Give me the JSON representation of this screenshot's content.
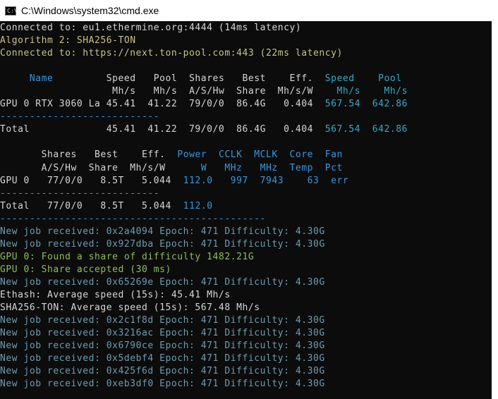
{
  "window": {
    "title": "C:\\Windows\\system32\\cmd.exe",
    "icon": "cmd-icon",
    "icon_glyph": "C:\\"
  },
  "lines": [
    {
      "spans": [
        {
          "t": "Connected to: eu1.ethermine.org:4444 (14ms latency)",
          "c": "w"
        }
      ]
    },
    {
      "spans": [
        {
          "t": "Algorithm 2: SHA256-TON",
          "c": "y"
        }
      ]
    },
    {
      "spans": [
        {
          "t": "Connected to: https://next.ton-pool.com:443 (22ms latency)",
          "c": "y"
        }
      ]
    },
    {
      "spans": [
        {
          "t": "",
          "c": "w"
        }
      ]
    },
    {
      "spans": [
        {
          "t": "     Name         ",
          "c": "c"
        },
        {
          "t": "Speed   Pool  Shares   Best    Eff.  ",
          "c": "w"
        },
        {
          "t": "Speed    Pool",
          "c": "cy"
        }
      ]
    },
    {
      "spans": [
        {
          "t": "                   ",
          "c": "w"
        },
        {
          "t": "Mh/s   Mh/s  A/S/Hw  Share  Mh/s/W    ",
          "c": "w"
        },
        {
          "t": "Mh/s    Mh/s",
          "c": "cy"
        }
      ]
    },
    {
      "spans": [
        {
          "t": "GPU 0 RTX 3060 La 45.41  41.22  79/0/0  86.4G   0.404  ",
          "c": "w"
        },
        {
          "t": "567.54  642.86",
          "c": "cy"
        }
      ]
    },
    {
      "spans": [
        {
          "t": "---------------------------",
          "c": "c"
        }
      ]
    },
    {
      "spans": [
        {
          "t": "Total             45.41  41.22  79/0/0  86.4G   0.404  ",
          "c": "w"
        },
        {
          "t": "567.54  642.86",
          "c": "cy"
        }
      ]
    },
    {
      "spans": [
        {
          "t": "",
          "c": "w"
        }
      ]
    },
    {
      "spans": [
        {
          "t": "       Shares   Best    Eff.  ",
          "c": "w"
        },
        {
          "t": "Power  CCLK  MCLK  Core  Fan",
          "c": "c"
        }
      ]
    },
    {
      "spans": [
        {
          "t": "       A/S/Hw  Share  Mh/s/W      ",
          "c": "w"
        },
        {
          "t": "W   MHz   MHz  Temp  Pct",
          "c": "c"
        }
      ]
    },
    {
      "spans": [
        {
          "t": "GPU 0   77/0/0   8.5T   5.044  ",
          "c": "w"
        },
        {
          "t": "112.0   997  7943    63  err",
          "c": "c"
        }
      ]
    },
    {
      "spans": [
        {
          "t": "---------------------------",
          "c": "c"
        }
      ]
    },
    {
      "spans": [
        {
          "t": "Total   77/0/0   8.5T   5.044  ",
          "c": "w"
        },
        {
          "t": "112.0",
          "c": "c"
        }
      ]
    },
    {
      "spans": [
        {
          "t": "---------------------------------------------",
          "c": "c"
        }
      ]
    },
    {
      "spans": [
        {
          "t": "New job received: 0x2a4094 Epoch: 471 Difficulty: 4.30G",
          "c": "gr"
        }
      ]
    },
    {
      "spans": [
        {
          "t": "New job received: 0x927dba Epoch: 471 Difficulty: 4.30G",
          "c": "gr"
        }
      ]
    },
    {
      "spans": [
        {
          "t": "GPU 0: Found a share of difficulty 1482.21G",
          "c": "g"
        }
      ]
    },
    {
      "spans": [
        {
          "t": "GPU 0: Share accepted (30 ms)",
          "c": "g"
        }
      ]
    },
    {
      "spans": [
        {
          "t": "New job received: 0x65269e Epoch: 471 Difficulty: 4.30G",
          "c": "gr"
        }
      ]
    },
    {
      "spans": [
        {
          "t": "Ethash: Average speed (15s): 45.41 Mh/s",
          "c": "w"
        }
      ]
    },
    {
      "spans": [
        {
          "t": "SHA256-TON: Average speed (15s): 567.48 Mh/s",
          "c": "w"
        }
      ]
    },
    {
      "spans": [
        {
          "t": "New job received: 0x2c1f8d Epoch: 471 Difficulty: 4.30G",
          "c": "gr"
        }
      ]
    },
    {
      "spans": [
        {
          "t": "New job received: 0x3216ac Epoch: 471 Difficulty: 4.30G",
          "c": "gr"
        }
      ]
    },
    {
      "spans": [
        {
          "t": "New job received: 0x6790ce Epoch: 471 Difficulty: 4.30G",
          "c": "gr"
        }
      ]
    },
    {
      "spans": [
        {
          "t": "New job received: 0x5debf4 Epoch: 471 Difficulty: 4.30G",
          "c": "gr"
        }
      ]
    },
    {
      "spans": [
        {
          "t": "New job received: 0x425f6d Epoch: 471 Difficulty: 4.30G",
          "c": "gr"
        }
      ]
    },
    {
      "spans": [
        {
          "t": "New job received: 0xeb3df0 Epoch: 471 Difficulty: 4.30G",
          "c": "gr"
        }
      ]
    }
  ],
  "colors": {
    "background": "#0c0c0c",
    "text": "#d6d6d6",
    "header_blue": "#3a96dd",
    "ton_column": "#3aa7c8",
    "share_green": "#8fbc5e",
    "algo_yellow": "#c9c28a",
    "job_text": "#6f9bb0"
  }
}
